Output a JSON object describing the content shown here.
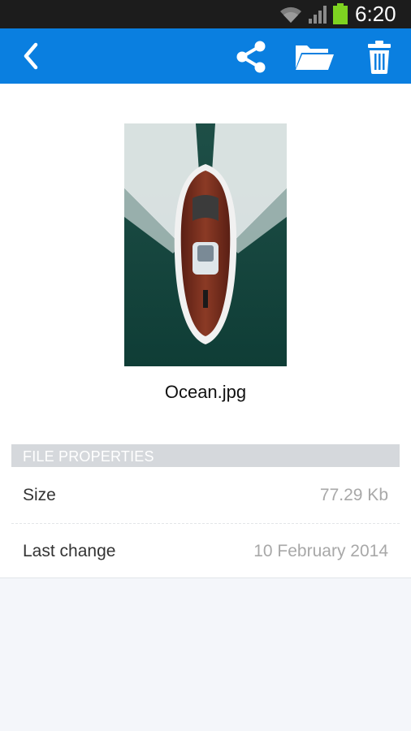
{
  "status_bar": {
    "time": "6:20",
    "icons": [
      "wifi-icon",
      "signal-icon",
      "battery-icon"
    ],
    "battery_color": "#7ed321"
  },
  "toolbar": {
    "background": "#0a7fe0",
    "actions": [
      {
        "name": "back",
        "icon": "chevron-left-icon"
      },
      {
        "name": "share",
        "icon": "share-icon"
      },
      {
        "name": "open-folder",
        "icon": "folder-icon"
      },
      {
        "name": "delete",
        "icon": "trash-icon"
      }
    ]
  },
  "file": {
    "name": "Ocean.jpg",
    "thumbnail": "boat-photo"
  },
  "properties": {
    "header": "FILE PROPERTIES",
    "rows": [
      {
        "label": "Size",
        "value": "77.29 Kb"
      },
      {
        "label": "Last change",
        "value": "10 February 2014"
      }
    ]
  }
}
